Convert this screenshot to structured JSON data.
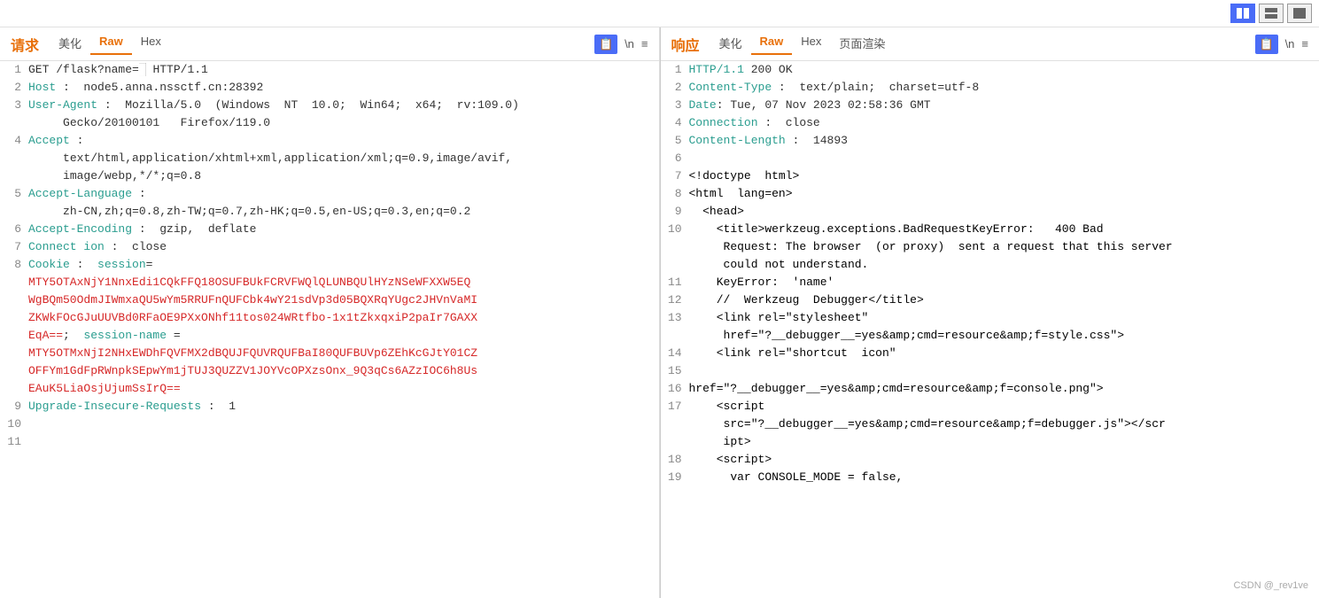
{
  "topbar": {
    "buttons": [
      "split-icon",
      "minus-icon",
      "square-icon"
    ],
    "active": 0
  },
  "left_panel": {
    "title": "请求",
    "tabs": [
      "美化",
      "Raw",
      "Hex"
    ],
    "active_tab": 1,
    "action_icon": "📋",
    "action_ln": "\\n",
    "action_menu": "≡",
    "lines": [
      {
        "num": 1,
        "key": "",
        "val": "",
        "raw": "GET /flask?name=█ HTTP/1.1"
      },
      {
        "num": 2,
        "key": "Host",
        "val": " node5.anna.nssctf.cn:28392"
      },
      {
        "num": 3,
        "key": "User-Agent",
        "val": " Mozilla/5.0 (Windows NT 10.0; Win64; x64; rv:109.0)\n         Gecko/20100101  Firefox/119.0"
      },
      {
        "num": 4,
        "key": "Accept",
        "val": " \n         text/html,application/xhtml+xml,application/xml;q=0.9,image/avif,\n         image/webp,*/*;q=0.8"
      },
      {
        "num": 5,
        "key": "Accept-Language",
        "val": " \n         zh-CN,zh;q=0.8,zh-TW;q=0.7,zh-HK;q=0.5,en-US;q=0.3,en;q=0.2"
      },
      {
        "num": 6,
        "key": "Accept-Encoding",
        "val": " gzip, deflate"
      },
      {
        "num": 7,
        "key": "Connection",
        "val": " close"
      },
      {
        "num": 8,
        "key": "Cookie",
        "val": " session=\n         MTY5OTAxNjY1NnxEdi1CQkFFQ18OSUFBUkFCRVFWQlQLUNBQUlHYzNSeWFXXW5EQ\n         WdBQm50OdmJIWmxaQU5wYm5RRUFnQUFCbk4wY21sdVp3d05BQXRqYUdc2JHVnVaMI\n         ZKWkFOcGJuUUVBd0RFaOE9PXxONhf11tos024WRtfbo-1x1tZkxqxiP2paIr7GAXX\n         EqA==; session-name =\n         MTY5OTMxNjI2NHxEWDhFQVFMX2dBQUJFQUVRQUFBaI80QUFBUVp6ZEhKcGJtY01CZ\n         OFFYm1GdFpRWnpkSEpwYm1jTUJ3QUZZV1JOYVcOPXzsOnx_9Q3qCs6AZzIOC6h8Us\n         EAuK5LiaOsjUjumSsIrQ=="
      },
      {
        "num": 9,
        "key": "Upgrade-Insecure-Requests",
        "val": " 1"
      },
      {
        "num": 10,
        "key": "",
        "val": ""
      },
      {
        "num": 11,
        "key": "",
        "val": ""
      }
    ]
  },
  "right_panel": {
    "title": "响应",
    "tabs": [
      "美化",
      "Raw",
      "Hex",
      "页面渲染"
    ],
    "active_tab": 1,
    "action_icon": "📋",
    "action_ln": "\\n",
    "action_menu": "≡",
    "lines": [
      {
        "num": 1,
        "text": "HTTP/1.1 200 OK"
      },
      {
        "num": 2,
        "text": "Content-Type : text/plain;  charset=utf-8"
      },
      {
        "num": 3,
        "text": "Date: Tue, 07 Nov 2023 02:58:36 GMT"
      },
      {
        "num": 4,
        "text": "Connection : close"
      },
      {
        "num": 5,
        "text": "Content-Length : 14893"
      },
      {
        "num": 6,
        "text": ""
      },
      {
        "num": 7,
        "text": "<!doctype html>"
      },
      {
        "num": 8,
        "text": "<html  lang=en>"
      },
      {
        "num": 9,
        "text": "  <head>"
      },
      {
        "num": 10,
        "text": "    <title>werkzeug.exceptions.BadRequestKeyError:   400 Bad\n         Request: The browser (or proxy) sent a request that this server\n         could not understand."
      },
      {
        "num": 11,
        "text": "    KeyError: 'name'"
      },
      {
        "num": 12,
        "text": "    // Werkzeug Debugger</title>"
      },
      {
        "num": 13,
        "text": "    <link rel=\"stylesheet\"\n         href=\"?__debugger__=yes&amp;cmd=resource&amp;f=style.css\">"
      },
      {
        "num": 14,
        "text": "    <link rel=\"shortcut  icon\""
      },
      {
        "num": 15,
        "text": ""
      },
      {
        "num": 16,
        "text": "href=\"?__debugger__=yes&amp;cmd=resource&amp;f=console.png\">"
      },
      {
        "num": 17,
        "text": "    <script\n         src=\"?__debugger__=yes&amp;cmd=resource&amp;f=debugger.js\"></scr\n         ipt>"
      },
      {
        "num": 18,
        "text": "    <script>"
      },
      {
        "num": 19,
        "text": "      var CONSOLE_MODE = false,"
      }
    ]
  },
  "watermark": "CSDN @_rev1ve"
}
